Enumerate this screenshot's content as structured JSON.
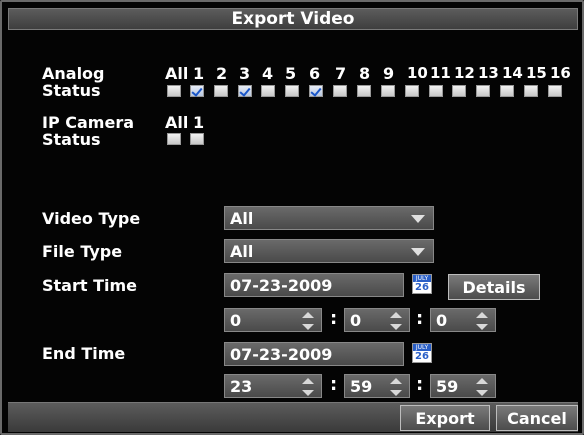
{
  "title": "Export Video",
  "analog": {
    "label_line1": "Analog",
    "label_line2": "Status",
    "all_label": "All",
    "channels": [
      "1",
      "2",
      "3",
      "4",
      "5",
      "6",
      "7",
      "8",
      "9",
      "10",
      "11",
      "12",
      "13",
      "14",
      "15",
      "16"
    ],
    "checked": [
      false,
      true,
      false,
      true,
      false,
      false,
      true,
      false,
      false,
      false,
      false,
      false,
      false,
      false,
      false,
      false,
      false
    ]
  },
  "ip_camera": {
    "label_line1": "IP Camera",
    "label_line2": "Status",
    "all_label": "All",
    "channels": [
      "1"
    ]
  },
  "fields": {
    "video_type_label": "Video Type",
    "video_type_value": "All",
    "file_type_label": "File Type",
    "file_type_value": "All",
    "start_time_label": "Start Time",
    "start_date": "07-23-2009",
    "start_hour": "0",
    "start_min": "0",
    "start_sec": "0",
    "end_time_label": "End Time",
    "end_date": "07-23-2009",
    "end_hour": "23",
    "end_min": "59",
    "end_sec": "59",
    "colon": ":",
    "calendar_month": "JULY",
    "calendar_day": "26"
  },
  "buttons": {
    "details": "Details",
    "export": "Export",
    "cancel": "Cancel"
  }
}
